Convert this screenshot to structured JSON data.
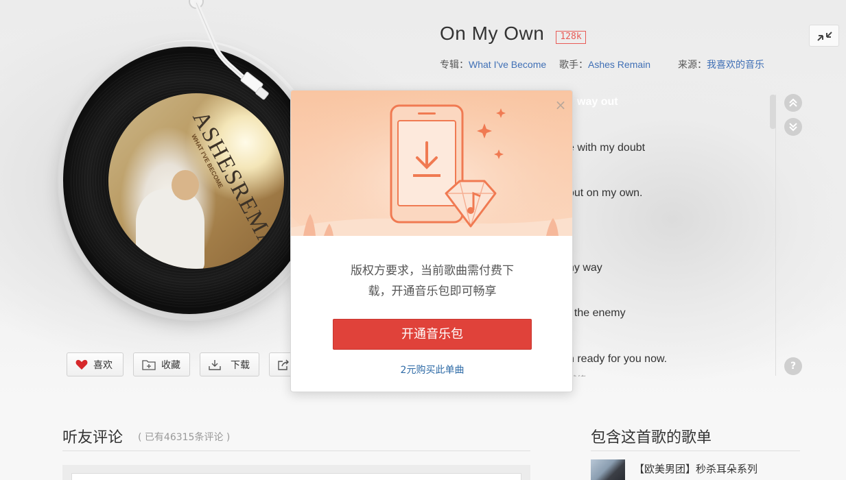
{
  "player": {
    "song_title": "On My Own",
    "quality_badge": "128k",
    "album_label": "专辑：",
    "album_name": "What I've Become",
    "artist_label": "歌手：",
    "artist_name": "Ashes Remain",
    "source_label": "来源：",
    "source_name": "我喜欢的音乐",
    "cover_title": "ASHESREMAIN",
    "cover_subtitle": "WHAT I'VE BECOME"
  },
  "lyrics": [
    {
      "text": "way out",
      "state": "active"
    },
    {
      "text": "e with my doubt",
      "state": "normal"
    },
    {
      "text": "out on my own.",
      "state": "normal"
    },
    {
      "text": "ny way",
      "state": "normal"
    },
    {
      "text": "f the enemy",
      "state": "normal"
    },
    {
      "text": "n ready for you now.",
      "state": "normal"
    },
    {
      "text": "就绪",
      "state": "faded"
    }
  ],
  "actions": {
    "like": "喜欢",
    "collect": "收藏",
    "download": "下载"
  },
  "dialog": {
    "message_line1": "版权方要求，当前歌曲需付费下",
    "message_line2": "载，开通音乐包即可畅享",
    "cta": "开通音乐包",
    "buy_single": "2元购买此单曲",
    "close_symbol": "×"
  },
  "comments": {
    "title": "听友评论",
    "count_text": "( 已有46315条评论 )"
  },
  "playlists": {
    "title": "包含这首歌的歌单",
    "items": [
      "【欧美男团】秒杀耳朵系列"
    ]
  },
  "colors": {
    "accent_red": "#e0423a",
    "link_blue": "#3f6fb5",
    "quality_red": "#e85a55",
    "dialog_hero_bg": "#f9c9a8"
  }
}
